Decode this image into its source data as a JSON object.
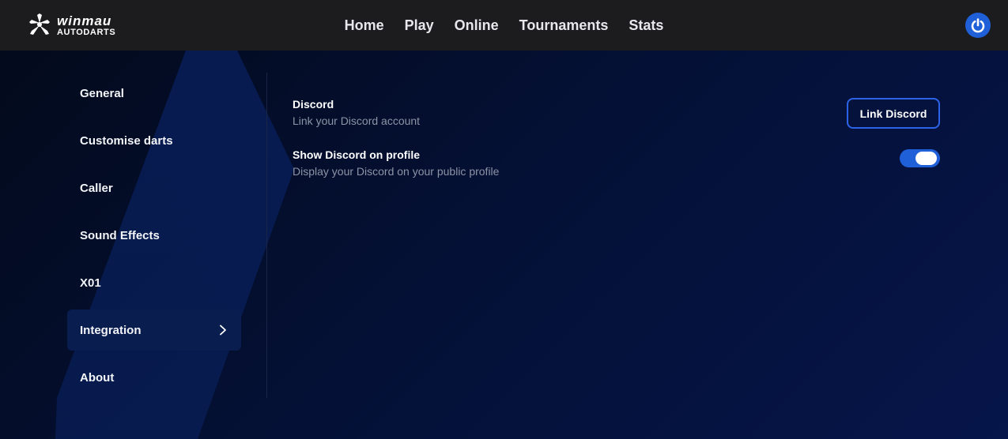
{
  "brand": {
    "name": "winmau",
    "subtitle": "AUTODARTS"
  },
  "nav": {
    "items": [
      "Home",
      "Play",
      "Online",
      "Tournaments",
      "Stats"
    ]
  },
  "sidebar": {
    "items": [
      {
        "label": "General",
        "active": false
      },
      {
        "label": "Customise darts",
        "active": false
      },
      {
        "label": "Caller",
        "active": false
      },
      {
        "label": "Sound Effects",
        "active": false
      },
      {
        "label": "X01",
        "active": false
      },
      {
        "label": "Integration",
        "active": true
      },
      {
        "label": "About",
        "active": false
      }
    ]
  },
  "settings": {
    "discord": {
      "title": "Discord",
      "description": "Link your Discord account",
      "button_label": "Link Discord"
    },
    "show_on_profile": {
      "title": "Show Discord on profile",
      "description": "Display your Discord on your public profile",
      "enabled": true
    }
  },
  "colors": {
    "accent": "#1f5fd8",
    "topbar": "#1c1c1e",
    "active_item": "#0a1d4f"
  },
  "icons": {
    "logo": "dart-star-icon",
    "power": "power-icon",
    "chevron": "chevron-right-icon"
  }
}
